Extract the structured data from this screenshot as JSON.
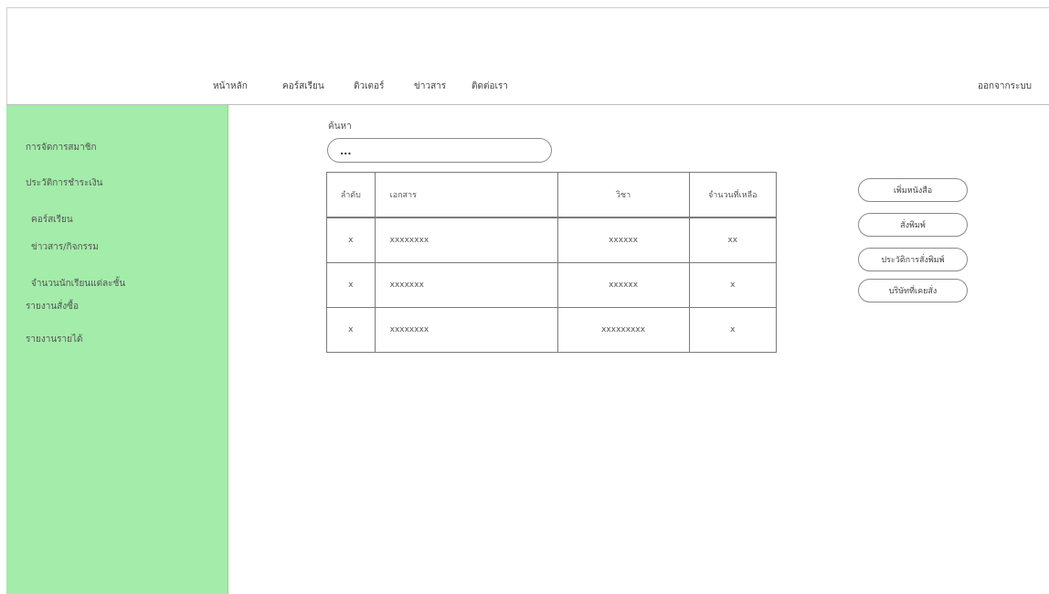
{
  "nav": {
    "items": [
      "หน้าหลัก",
      "คอร์สเรียน",
      "ติวเตอร์",
      "ข่าวสาร",
      "ติดต่อเรา"
    ],
    "logout": "ออกจากระบบ"
  },
  "sidebar": {
    "items": [
      "การจัดการสมาชิก",
      "ประวัติการชำระเงิน",
      "คอร์สเรียน",
      "ข่าวสาร/กิจกรรม",
      "จำนวนนักเรียนแต่ละชั้น",
      "รายงานสั่งซื้อ",
      "รายงานรายได้"
    ]
  },
  "search": {
    "label": "ค้นหา",
    "value": "..."
  },
  "table": {
    "headers": [
      "ลำดับ",
      "เอกสาร",
      "วิชา",
      "จำนวนที่เหลือ"
    ],
    "rows": [
      [
        "x",
        "xxxxxxxx",
        "xxxxxx",
        "xx"
      ],
      [
        "x",
        "xxxxxxx",
        "xxxxxx",
        "x"
      ],
      [
        "x",
        "xxxxxxxx",
        "xxxxxxxxx",
        "x"
      ]
    ]
  },
  "actions": {
    "add_book": "เพิ่มหนังสือ",
    "order_print": "สั่งพิมพ์",
    "print_history": "ประวัติการสั่งพิมพ์",
    "previous_company": "บริษัทที่เคยสั่ง"
  },
  "colors": {
    "sidebar_bg": "#a3eca9",
    "border": "#7a7a7a"
  }
}
